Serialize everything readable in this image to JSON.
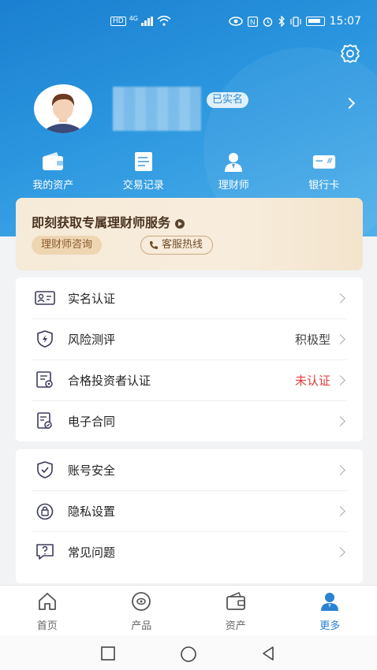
{
  "status_bar": {
    "left_tags": [
      "HD",
      "4G"
    ],
    "time": "15:07"
  },
  "profile": {
    "verified_badge": "已实名"
  },
  "quick_nav": [
    {
      "label": "我的资产",
      "icon": "wallet-icon"
    },
    {
      "label": "交易记录",
      "icon": "document-icon"
    },
    {
      "label": "理财师",
      "icon": "advisor-icon"
    },
    {
      "label": "银行卡",
      "icon": "bank-card-icon"
    }
  ],
  "promo": {
    "title": "即刻获取专属理财师服务",
    "consult_button": "理财师咨询",
    "hotline_button": "客服热线"
  },
  "menu_group1": [
    {
      "label": "实名认证",
      "value": "",
      "icon": "id-card-icon"
    },
    {
      "label": "风险测评",
      "value": "积极型",
      "icon": "shield-bolt-icon"
    },
    {
      "label": "合格投资者认证",
      "value": "未认证",
      "icon": "certificate-icon"
    },
    {
      "label": "电子合同",
      "value": "",
      "icon": "contract-icon"
    }
  ],
  "menu_group2": [
    {
      "label": "账号安全",
      "icon": "shield-check-icon"
    },
    {
      "label": "隐私设置",
      "icon": "lock-icon"
    },
    {
      "label": "常见问题",
      "icon": "question-icon"
    }
  ],
  "tabbar": [
    {
      "label": "首页",
      "icon": "home-icon",
      "active": false
    },
    {
      "label": "产品",
      "icon": "product-icon",
      "active": false
    },
    {
      "label": "资产",
      "icon": "wallet-icon",
      "active": false
    },
    {
      "label": "更多",
      "icon": "person-icon",
      "active": true
    }
  ],
  "colors": {
    "header_blue": "#2b96df",
    "accent_blue": "#2a82d4",
    "warning_red": "#e03a3a",
    "promo_bg": "#f6ead8"
  }
}
